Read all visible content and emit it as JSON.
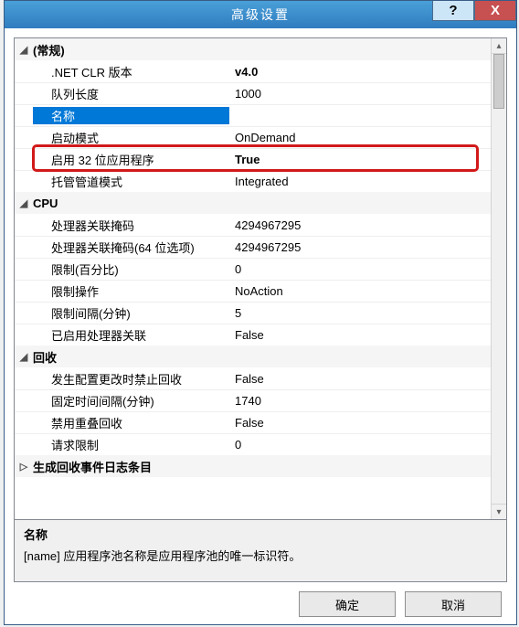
{
  "window": {
    "title": "高级设置",
    "help": "?",
    "close": "X"
  },
  "categories": {
    "general": "(常规)",
    "cpu": "CPU",
    "recycle": "回收",
    "genEvent": "生成回收事件日志条目"
  },
  "props": {
    "clr": {
      "name": ".NET CLR 版本",
      "value": "v4.0"
    },
    "qlen": {
      "name": "队列长度",
      "value": "1000"
    },
    "name": {
      "name": "名称",
      "value": " "
    },
    "start": {
      "name": "启动模式",
      "value": "OnDemand"
    },
    "bit32": {
      "name": "启用 32 位应用程序",
      "value": "True"
    },
    "pipe": {
      "name": "托管管道模式",
      "value": "Integrated"
    },
    "mask": {
      "name": "处理器关联掩码",
      "value": "4294967295"
    },
    "mask64": {
      "name": "处理器关联掩码(64 位选项)",
      "value": "4294967295"
    },
    "limit": {
      "name": "限制(百分比)",
      "value": "0"
    },
    "limitAction": {
      "name": "限制操作",
      "value": "NoAction"
    },
    "limitInt": {
      "name": "限制间隔(分钟)",
      "value": "5"
    },
    "affEnabled": {
      "name": "已启用处理器关联",
      "value": "False"
    },
    "noRecycleCfg": {
      "name": "发生配置更改时禁止回收",
      "value": "False"
    },
    "fixedInt": {
      "name": "固定时间间隔(分钟)",
      "value": "1740"
    },
    "noOverlap": {
      "name": "禁用重叠回收",
      "value": "False"
    },
    "reqLimit": {
      "name": "请求限制",
      "value": "0"
    }
  },
  "desc": {
    "title": "名称",
    "text": "[name] 应用程序池名称是应用程序池的唯一标识符。"
  },
  "buttons": {
    "ok": "确定",
    "cancel": "取消"
  }
}
